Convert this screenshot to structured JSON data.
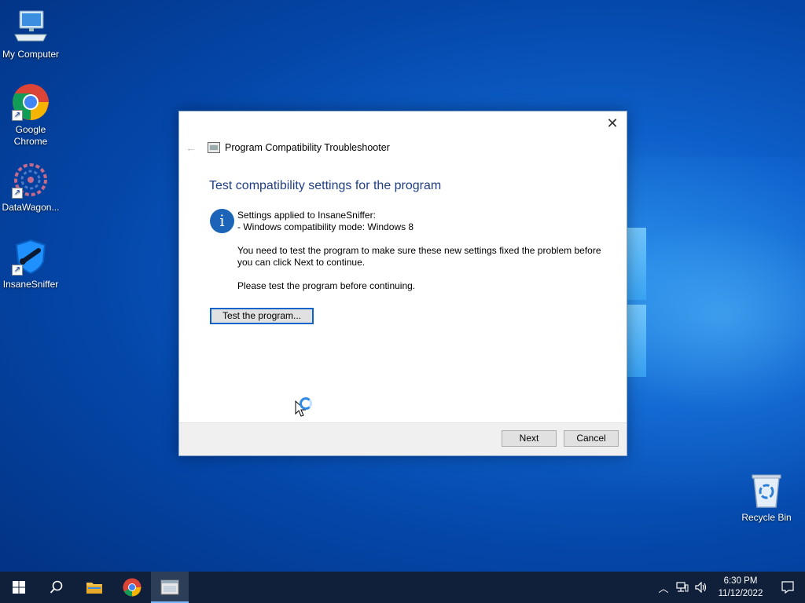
{
  "desktop": {
    "icons": [
      {
        "label": "My Computer"
      },
      {
        "label": "Google Chrome"
      },
      {
        "label": "DataWagon..."
      },
      {
        "label": "InsaneSniffer"
      },
      {
        "label": "Recycle Bin"
      }
    ]
  },
  "dialog": {
    "close_glyph": "✕",
    "back_glyph": "←",
    "app_title": "Program Compatibility Troubleshooter",
    "heading": "Test compatibility settings for the program",
    "info_glyph": "i",
    "lines": {
      "settings_applied": "Settings applied to InsaneSniffer:",
      "compat_mode": "- Windows compatibility mode: Windows 8",
      "need_test_1": "You need to test the program to make sure these new settings fixed the problem before",
      "need_test_2": "you can click Next to continue.",
      "please_test": "Please test the program before continuing."
    },
    "test_button_label": "Test the program...",
    "next_label": "Next",
    "cancel_label": "Cancel"
  },
  "taskbar": {
    "clock_time": "6:30 PM",
    "clock_date": "11/12/2022",
    "chevron_glyph": "︿"
  },
  "colors": {
    "heading": "#1f3f84",
    "accent": "#0a63c9",
    "taskbar": "#10203a"
  }
}
